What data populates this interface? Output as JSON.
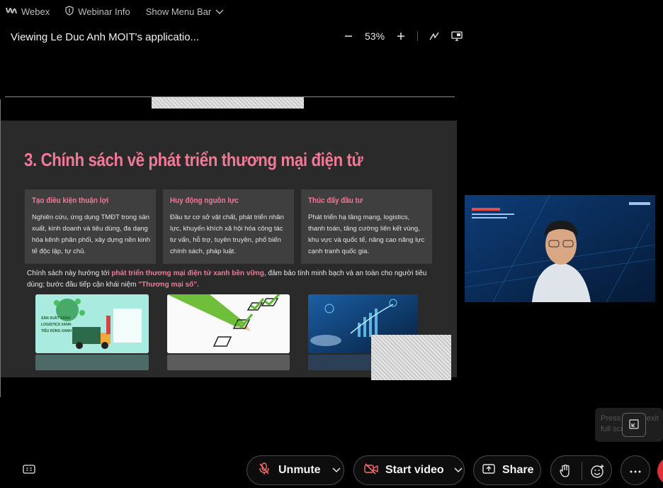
{
  "topbar": {
    "app_name": "Webex",
    "webinar_info": "Webinar Info",
    "show_menu_bar": "Show Menu Bar"
  },
  "viewer": {
    "viewing_title": "Viewing Le Duc Anh MOIT's applicatio...",
    "zoom_level": "53%"
  },
  "slide": {
    "title": "3. Chính sách về phát triển thương mại điện tử",
    "boxes": [
      {
        "heading": "Tạo điều kiện thuận lợi",
        "body": "Nghiên cứu, ứng dụng TMĐT trong sản xuất, kinh doanh và tiêu dùng, đa dạng hóa kênh phân phối, xây dựng nền kinh tế độc lập, tự chủ."
      },
      {
        "heading": "Huy động nguồn lực",
        "body": "Đầu tư cơ sở vật chất, phát triển nhân lực, khuyến khích xã hội hóa công tác tư vấn, hỗ trợ, tuyên truyền, phổ biến chính sách, pháp luật."
      },
      {
        "heading": "Thúc đẩy đầu tư",
        "body": "Phát triển hạ tầng mạng, logistics, thanh toán, tăng cường liên kết vùng, khu vực và quốc tế, nâng cao năng lực cạnh tranh quốc gia."
      }
    ],
    "para_part1": "Chính sách này hướng tới ",
    "para_highlight": "phát triển thương mại điện tử xanh bền vững",
    "para_part2": ", đảm bảo tính minh bạch và an toàn cho người tiêu dùng; bước đầu tiếp cận khái niệm ",
    "para_highlight2": "\"Thương mại số\"",
    "para_end": ".",
    "img1_lines": [
      "SẢN XUẤT XANH",
      "LOGISTICS XANH",
      "TIÊU DÙNG XANH"
    ]
  },
  "toast": {
    "text": "Press Esc to exit full screen"
  },
  "bottombar": {
    "unmute": "Unmute",
    "start_video": "Start video",
    "share": "Share"
  },
  "colors": {
    "accent": "#f27897",
    "danger": "#e0303a"
  }
}
